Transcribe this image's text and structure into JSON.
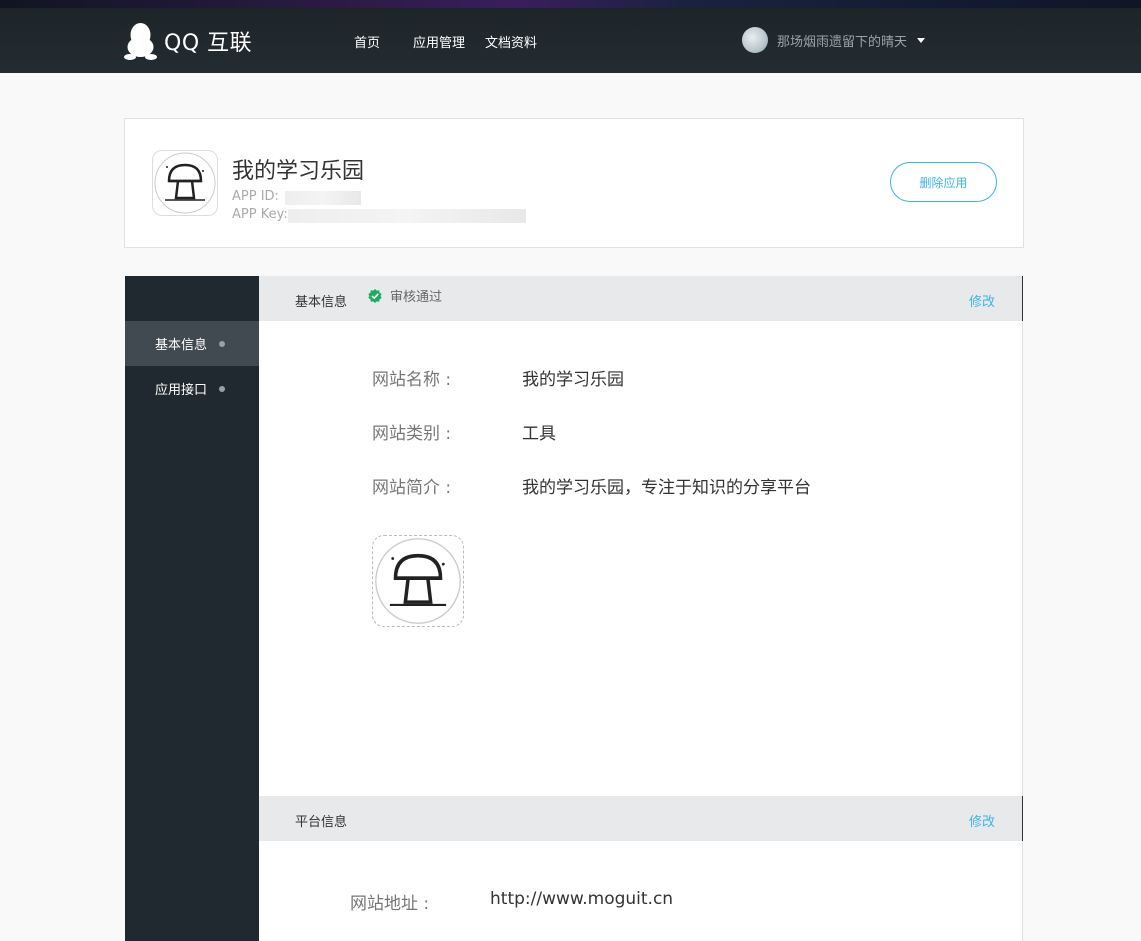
{
  "header": {
    "logo_text": "QQ 互联",
    "nav": [
      "首页",
      "应用管理",
      "文档资料"
    ],
    "user_name": "那场烟雨遗留下的晴天"
  },
  "app": {
    "name": "我的学习乐园",
    "app_id_label": "APP ID:",
    "app_key_label": "APP Key:",
    "delete_label": "删除应用"
  },
  "sidebar": {
    "items": [
      {
        "label": "基本信息",
        "active": true
      },
      {
        "label": "应用接口",
        "active": false
      }
    ]
  },
  "basic_info": {
    "title": "基本信息",
    "status": "审核通过",
    "edit": "修改",
    "rows": [
      {
        "label": "网站名称 :",
        "value": "我的学习乐园"
      },
      {
        "label": "网站类别 :",
        "value": "工具"
      },
      {
        "label": "网站简介 :",
        "value": "我的学习乐园，专注于知识的分享平台"
      }
    ]
  },
  "platform_info": {
    "title": "平台信息",
    "edit": "修改",
    "url_label": "网站地址 :",
    "url_value": "http://www.moguit.cn"
  },
  "colors": {
    "accent": "#3cb3e6",
    "topbar": "#20292f",
    "sidebar": "#20292f",
    "success": "#1aad5b"
  }
}
